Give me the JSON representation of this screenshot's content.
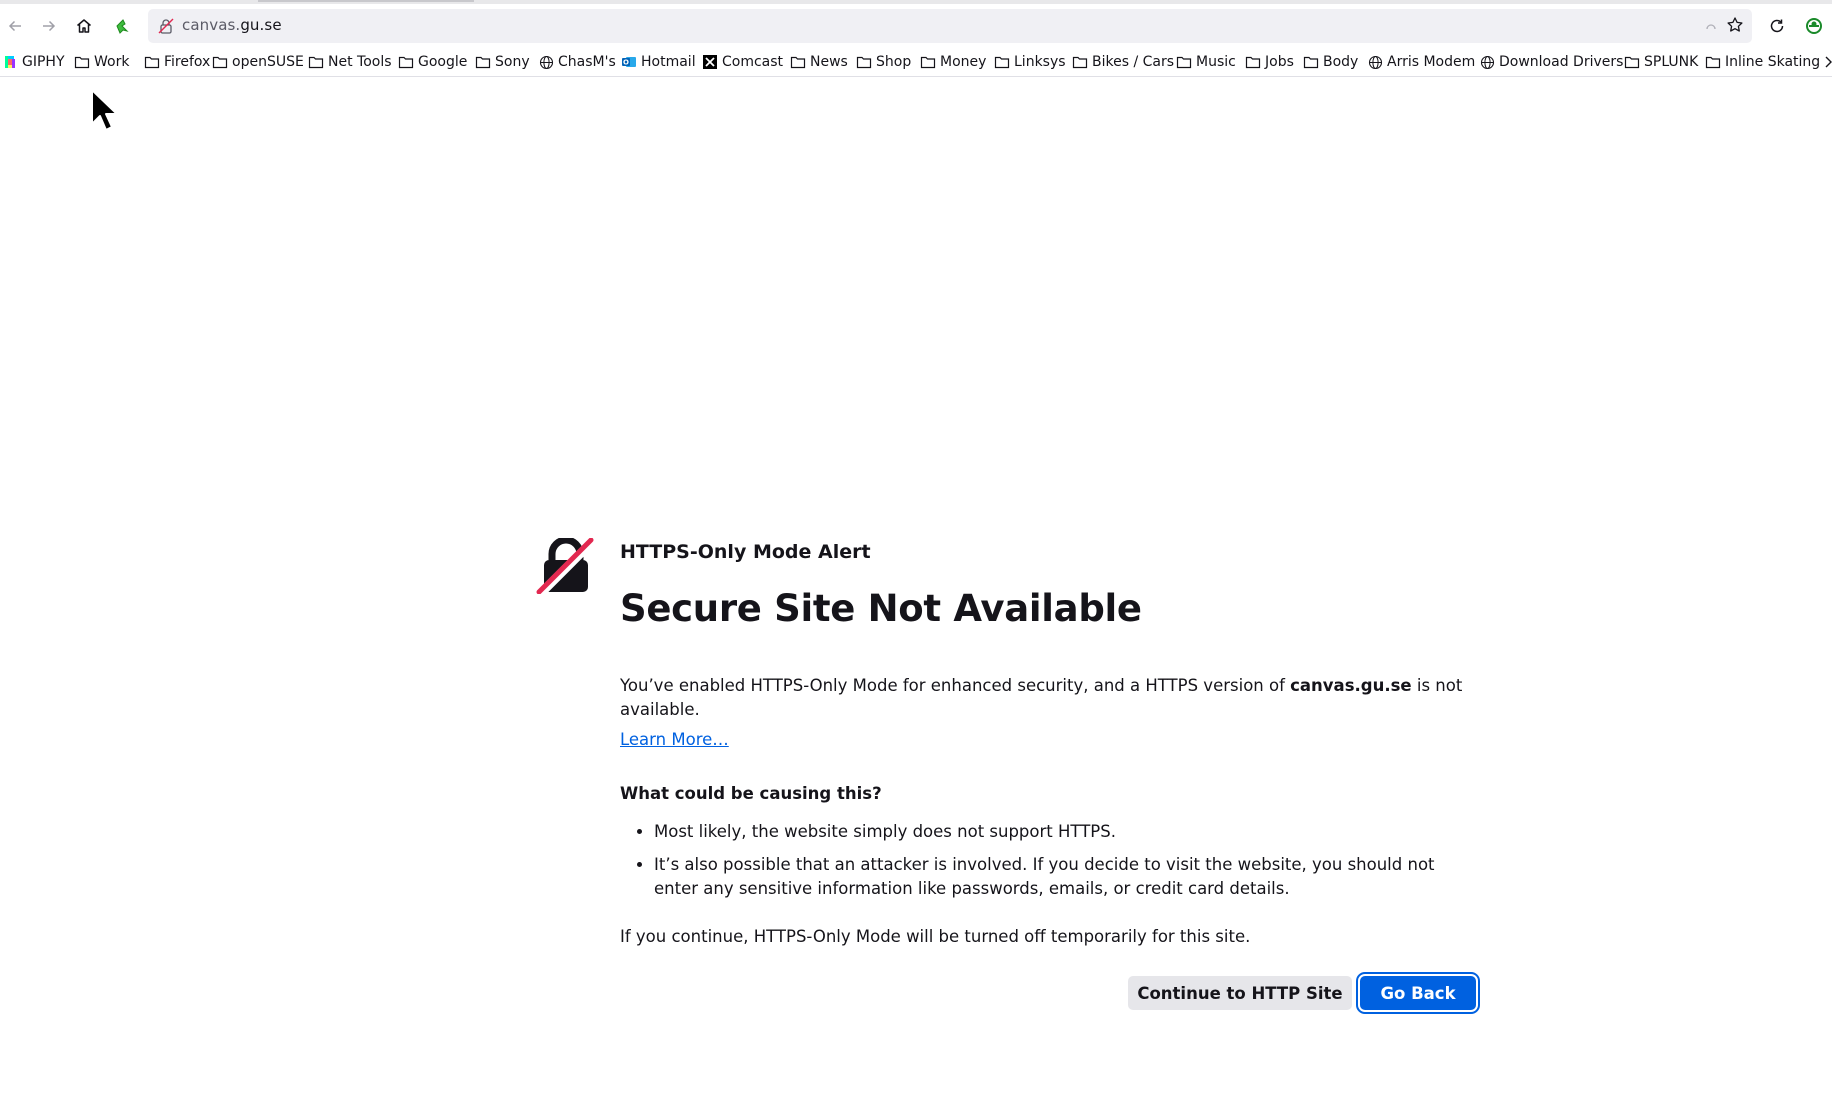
{
  "browser": {
    "url_prefix": "canvas.",
    "url_host": "gu.se",
    "nav_icons": [
      "back-arrow-icon",
      "forward-arrow-icon",
      "home-icon",
      "extension-icon"
    ],
    "right_icons": [
      "reader-view-icon",
      "star-icon",
      "reload-icon",
      "profile-icon"
    ]
  },
  "bookmarks": [
    {
      "label": "GIPHY",
      "icon": "giphy-icon"
    },
    {
      "label": "Work",
      "icon": "folder-icon"
    },
    {
      "label": "Firefox",
      "icon": "folder-icon"
    },
    {
      "label": "openSUSE",
      "icon": "folder-icon"
    },
    {
      "label": "Net Tools",
      "icon": "folder-icon"
    },
    {
      "label": "Google",
      "icon": "folder-icon"
    },
    {
      "label": "Sony",
      "icon": "folder-icon"
    },
    {
      "label": "ChasM's",
      "icon": "globe-icon"
    },
    {
      "label": "Hotmail",
      "icon": "outlook-icon"
    },
    {
      "label": "Comcast",
      "icon": "x-icon"
    },
    {
      "label": "News",
      "icon": "folder-icon"
    },
    {
      "label": "Shop",
      "icon": "folder-icon"
    },
    {
      "label": "Money",
      "icon": "folder-icon"
    },
    {
      "label": "Linksys",
      "icon": "folder-icon"
    },
    {
      "label": "Bikes / Cars",
      "icon": "folder-icon"
    },
    {
      "label": "Music",
      "icon": "folder-icon"
    },
    {
      "label": "Jobs",
      "icon": "folder-icon"
    },
    {
      "label": "Body",
      "icon": "folder-icon"
    },
    {
      "label": "Arris Modem",
      "icon": "globe-icon"
    },
    {
      "label": "Download Drivers",
      "icon": "globe-icon"
    },
    {
      "label": "SPLUNK",
      "icon": "folder-icon"
    },
    {
      "label": "Inline Skating",
      "icon": "folder-icon"
    }
  ],
  "page": {
    "label": "HTTPS-Only Mode Alert",
    "title": "Secure Site Not Available",
    "desc_before": "You’ve enabled HTTPS-Only Mode for enhanced security, and a HTTPS version of ",
    "desc_host": "canvas.gu.se",
    "desc_after": " is not available.",
    "learn_more": "Learn More…",
    "subhead": "What could be causing this?",
    "reasons": [
      "Most likely, the website simply does not support HTTPS.",
      "It’s also possible that an attacker is involved. If you decide to visit the website, you should not enter any sensitive information like passwords, emails, or credit card details."
    ],
    "footer": "If you continue, HTTPS-Only Mode will be turned off temporarily for this site.",
    "continue_button": "Continue to HTTP Site",
    "back_button": "Go Back"
  },
  "colors": {
    "accent": "#0061e0",
    "icon_slash": "#e22850"
  }
}
